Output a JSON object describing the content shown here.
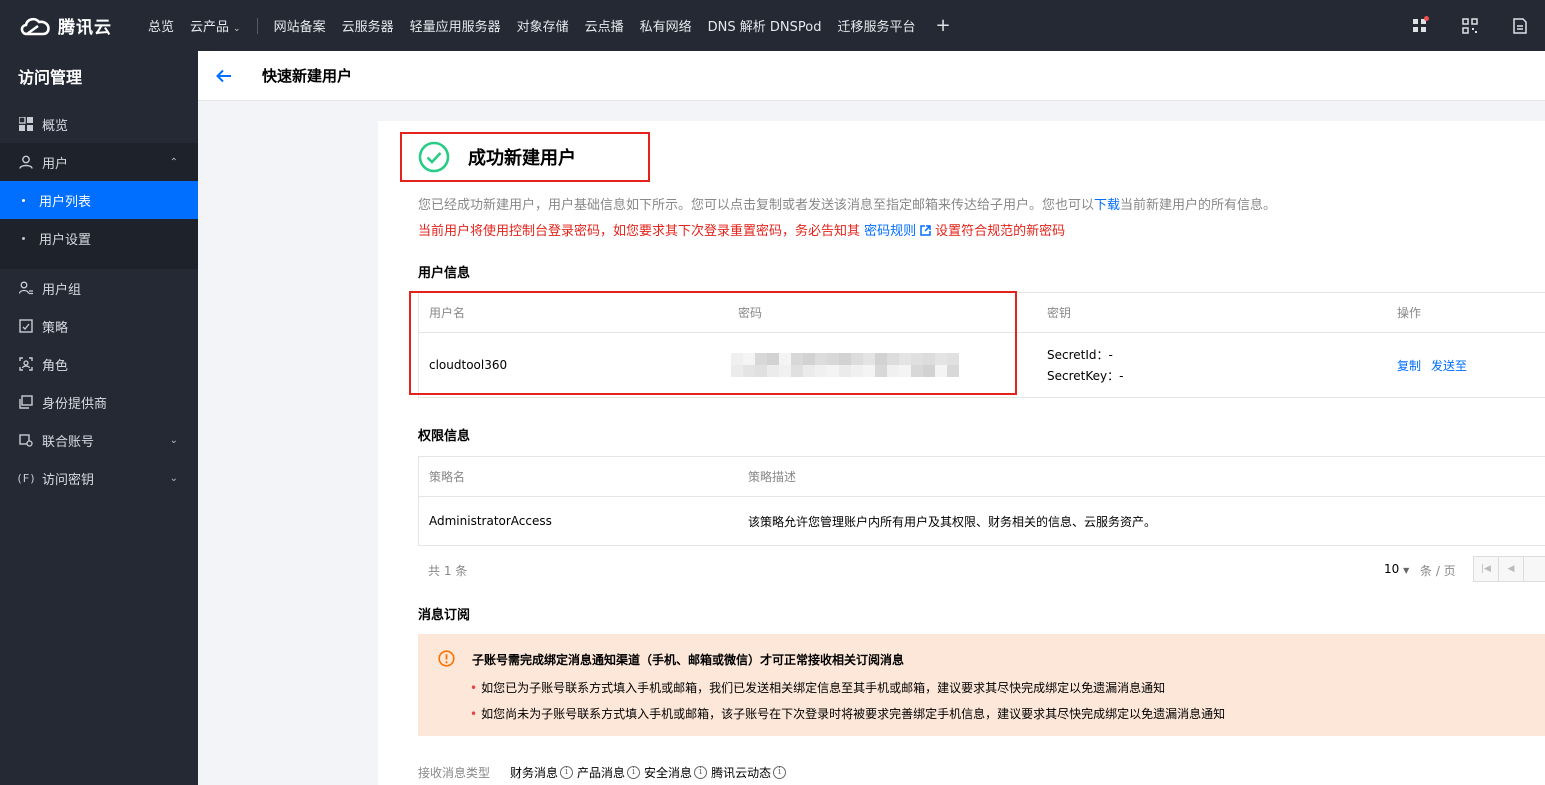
{
  "brand": {
    "name": "腾讯云"
  },
  "topnav": {
    "items": [
      "总览",
      "云产品"
    ],
    "quick": [
      "网站备案",
      "云服务器",
      "轻量应用服务器",
      "对象存储",
      "云点播",
      "私有网络",
      "DNS 解析 DNSPod",
      "迁移服务平台"
    ],
    "plus": "+"
  },
  "sidebar": {
    "title": "访问管理",
    "items": [
      {
        "label": "概览",
        "icon": "grid-icon"
      },
      {
        "label": "用户",
        "icon": "user-icon"
      },
      {
        "label": "用户组",
        "icon": "user-group-icon"
      },
      {
        "label": "策略",
        "icon": "policy-icon"
      },
      {
        "label": "角色",
        "icon": "role-icon"
      },
      {
        "label": "身份提供商",
        "icon": "identity-provider-icon"
      },
      {
        "label": "联合账号",
        "icon": "federated-account-icon"
      },
      {
        "label": "访问密钥",
        "icon": "access-key-icon"
      }
    ],
    "user_sub": [
      "用户列表",
      "用户设置"
    ]
  },
  "page": {
    "title": "快速新建用户",
    "success_title": "成功新建用户",
    "desc_prefix": "您已经成功新建用户，用户基础信息如下所示。您可以点击复制或者发送该消息至指定邮箱来传达给子用户。您也可以",
    "desc_link": "下载",
    "desc_suffix": "当前新建用户的所有信息。",
    "warn_prefix": "当前用户将使用控制台登录密码，如您要求其下次登录重置密码，务必告知其",
    "warn_link": "密码规则",
    "warn_suffix": "设置符合规范的新密码"
  },
  "user_info": {
    "title": "用户信息",
    "headers": [
      "用户名",
      "密码",
      "密钥",
      "操作"
    ],
    "row": {
      "username": "cloudtool360",
      "secret_id": "SecretId：-",
      "secret_key": "SecretKey：-",
      "actions": [
        "复制",
        "发送至"
      ]
    }
  },
  "perm_info": {
    "title": "权限信息",
    "headers": [
      "策略名",
      "策略描述"
    ],
    "row": {
      "name": "AdministratorAccess",
      "desc": "该策略允许您管理账户内所有用户及其权限、财务相关的信息、云服务资产。"
    }
  },
  "pager": {
    "total": "共  1  条",
    "size": "10",
    "per": "条 / 页"
  },
  "subscription": {
    "title": "消息订阅",
    "notice_head": "子账号需完成绑定消息通知渠道（手机、邮箱或微信）才可正常接收相关订阅消息",
    "notice_lines": [
      "如您已为子账号联系方式填入手机或邮箱，我们已发送相关绑定信息至其手机或邮箱，建议要求其尽快完成绑定以免遗漏消息通知",
      "如您尚未为子账号联系方式填入手机或邮箱，该子账号在下次登录时将被要求完善绑定手机信息，建议要求其尽快完成绑定以免遗漏消息通知"
    ],
    "recv_label": "接收消息类型",
    "recv_types": [
      "财务消息",
      "产品消息",
      "安全消息",
      "腾讯云动态"
    ]
  },
  "colors": {
    "accent": "#006eff",
    "danger": "#e3231b",
    "success": "#29cc85",
    "nav_bg": "#242934"
  }
}
